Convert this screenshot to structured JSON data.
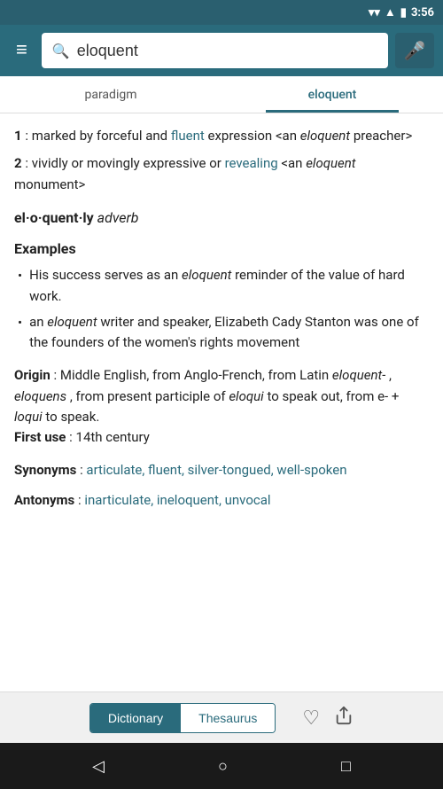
{
  "statusBar": {
    "time": "3:56",
    "icons": [
      "signal",
      "wifi",
      "battery"
    ]
  },
  "topBar": {
    "menuIcon": "≡",
    "searchValue": "eloquent",
    "micIcon": "🎤"
  },
  "tabs": [
    {
      "id": "paradigm",
      "label": "paradigm",
      "active": false
    },
    {
      "id": "eloquent",
      "label": "eloquent",
      "active": true
    }
  ],
  "content": {
    "definition1_num": "1",
    "definition1_colon": ":",
    "definition1_text": "marked by forceful and ",
    "definition1_link": "fluent",
    "definition1_rest": " expression <an ",
    "definition1_italic": "eloquent",
    "definition1_end": " preacher>",
    "definition2_num": "2",
    "definition2_colon": ":",
    "definition2_text": "vividly or movingly expressive or ",
    "definition2_link": "revealing",
    "definition2_rest": " <an ",
    "definition2_italic": "eloquent",
    "definition2_end": " monument>",
    "wordForm_headword": "el·o·quent·ly",
    "wordForm_pos": "adverb",
    "examples_title": "Examples",
    "examples": [
      {
        "text_before": "His success serves as an ",
        "italic": "eloquent",
        "text_after": " reminder of the value of hard work."
      },
      {
        "text_before": "an ",
        "italic": "eloquent",
        "text_after": " writer and speaker, Elizabeth Cady Stanton was one of the founders of the women's rights movement"
      }
    ],
    "origin_label": "Origin",
    "origin_text": ": Middle English, from Anglo-French, from Latin ",
    "origin_italic1": "eloquent-",
    "origin_comma": ", ",
    "origin_italic2": "eloquens",
    "origin_text2": ", from present participle of ",
    "origin_italic3": "eloqui",
    "origin_text3": " to speak out, from ",
    "origin_text4": "e-",
    "origin_text5": " + ",
    "origin_italic4": "loqui",
    "origin_text6": " to speak.",
    "firstuse_label": "First use",
    "firstuse_text": ": 14th century",
    "synonyms_label": "Synonyms",
    "synonyms_links": "articulate, fluent, silver-tongued, well-spoken",
    "antonyms_label": "Antonyms",
    "antonyms_links": "inarticulate, ineloquent, unvocal"
  },
  "bottomBar": {
    "dictionaryBtn": "Dictionary",
    "thesaurusBtn": "Thesaurus",
    "heartIcon": "♡",
    "shareIcon": "⎙"
  },
  "navBar": {
    "backIcon": "◁",
    "homeIcon": "○",
    "squareIcon": "□"
  }
}
